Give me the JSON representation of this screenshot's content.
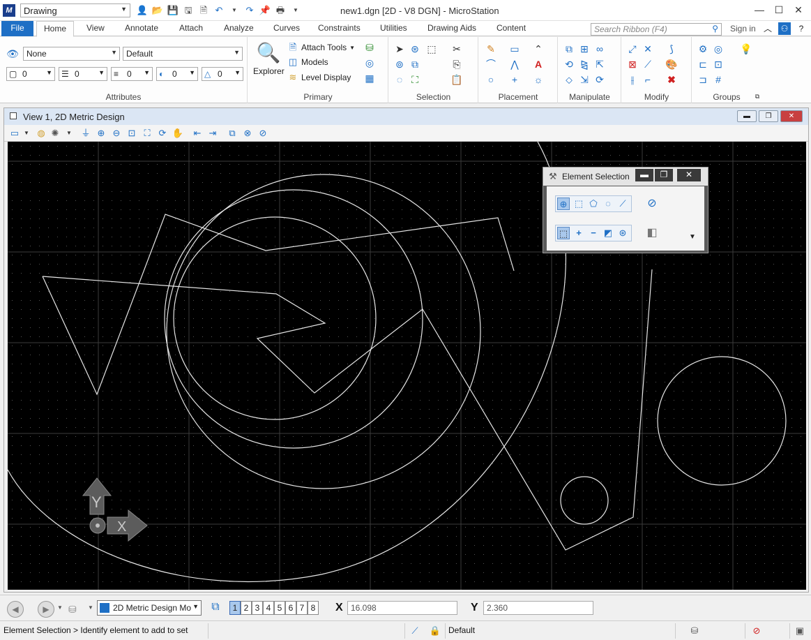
{
  "titlebar": {
    "workflow": "Drawing",
    "title": "new1.dgn [2D - V8 DGN] - MicroStation"
  },
  "ribbon_tabs": {
    "file": "File",
    "tabs": [
      "Home",
      "View",
      "Annotate",
      "Attach",
      "Analyze",
      "Curves",
      "Constraints",
      "Utilities",
      "Drawing Aids",
      "Content"
    ],
    "search_placeholder": "Search Ribbon (F4)",
    "sign_in": "Sign in"
  },
  "attributes": {
    "label": "Attributes",
    "level": "None",
    "style": "Default",
    "color": "0",
    "line_style": "0",
    "weight": "0",
    "transparency": "0",
    "priority": "0"
  },
  "primary": {
    "label": "Primary",
    "explorer": "Explorer",
    "attach_tools": "Attach Tools",
    "models": "Models",
    "level_display": "Level Display"
  },
  "groups": {
    "selection": "Selection",
    "placement": "Placement",
    "manipulate": "Manipulate",
    "modify": "Modify",
    "groups": "Groups"
  },
  "view": {
    "title": "View 1, 2D Metric Design"
  },
  "element_selection": {
    "title": "Element Selection"
  },
  "nav": {
    "model": "2D Metric Design Mo",
    "views": [
      "1",
      "2",
      "3",
      "4",
      "5",
      "6",
      "7",
      "8"
    ],
    "x_label": "X",
    "x_value": "16.098",
    "y_label": "Y",
    "y_value": "2.360"
  },
  "status": {
    "prompt": "Element Selection > Identify element to add to set",
    "level": "Default"
  },
  "axes_triad": {
    "y": "Y",
    "x": "X"
  }
}
